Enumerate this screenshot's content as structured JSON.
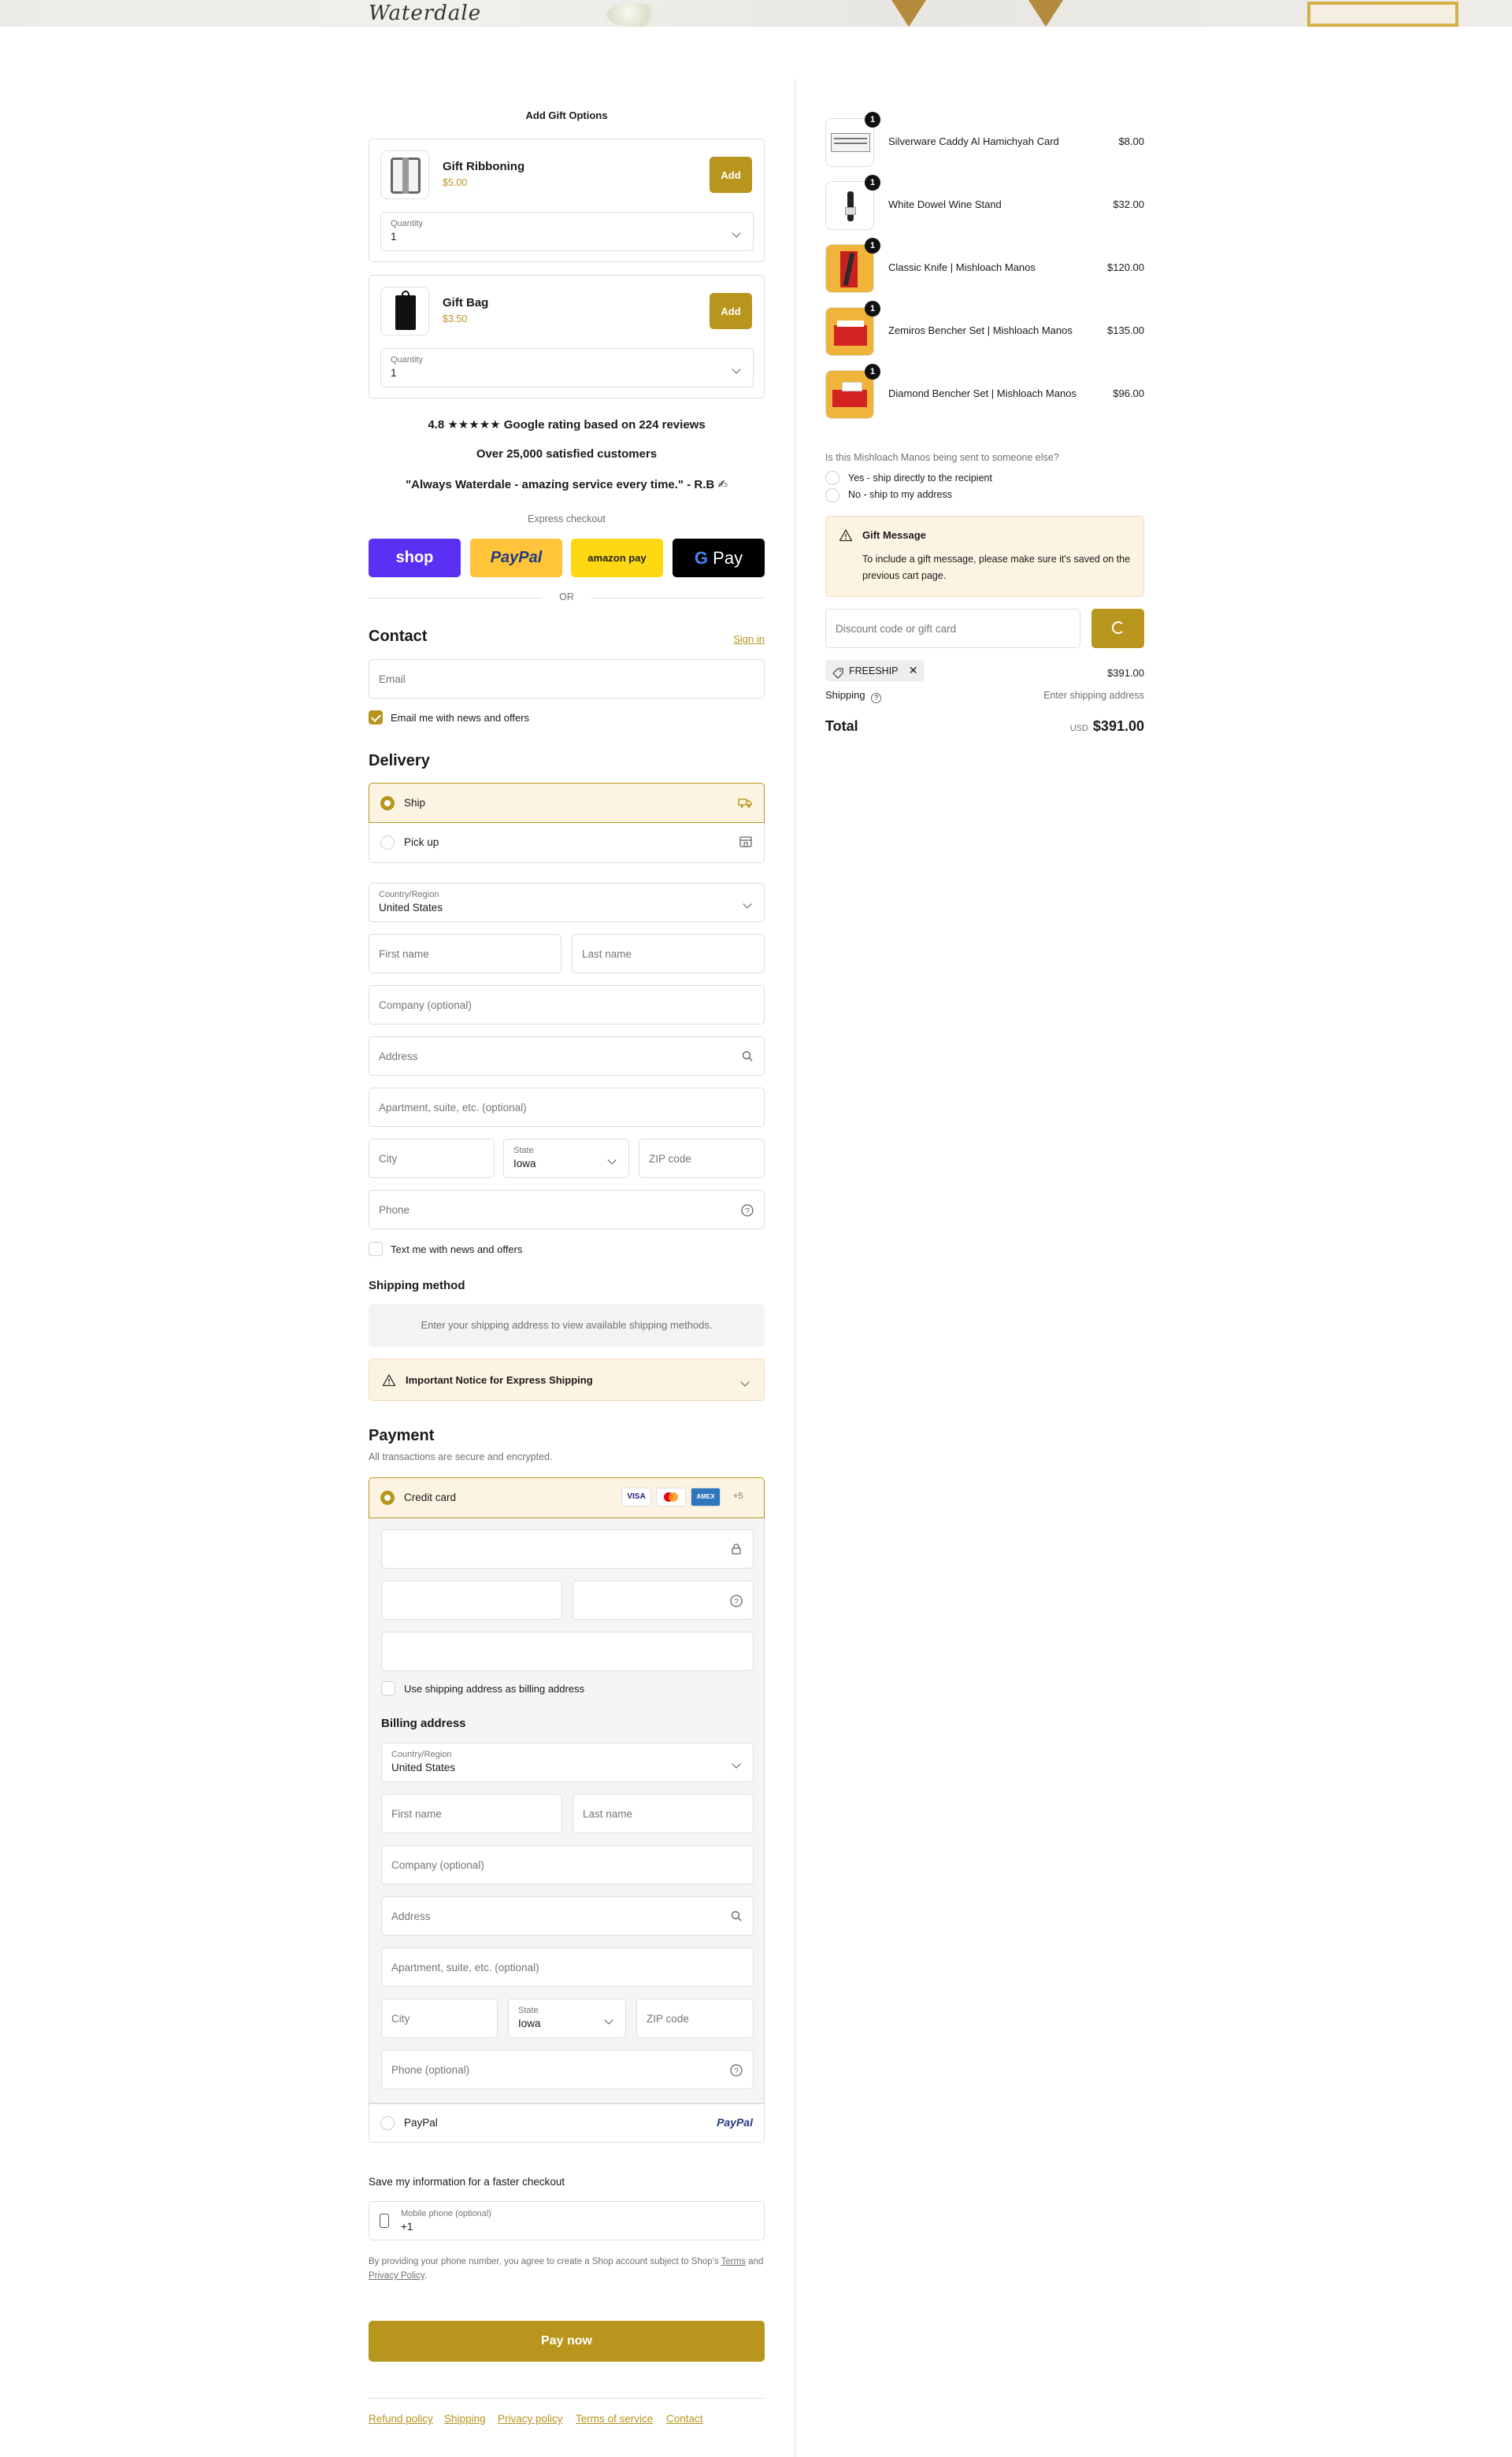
{
  "banner": {
    "logo_text": "Waterdale"
  },
  "gift_options": {
    "title": "Add Gift Options",
    "items": [
      {
        "name": "Gift Ribboning",
        "price": "$5.00",
        "button": "Add",
        "qty_label": "Quantity",
        "qty_value": "1"
      },
      {
        "name": "Gift Bag",
        "price": "$3.50",
        "button": "Add",
        "qty_label": "Quantity",
        "qty_value": "1"
      }
    ]
  },
  "trust": {
    "rating": "4.8 ★★★★★ Google rating based on 224 reviews",
    "customers": "Over 25,000 satisfied customers",
    "quote": "\"Always Waterdale - amazing service every time.\" - R.B ✍"
  },
  "express": {
    "label": "Express checkout",
    "buttons": {
      "shop": "shop",
      "paypal": "PayPal",
      "amazon": "amazon pay",
      "gpay": "Pay"
    },
    "or": "OR"
  },
  "contact": {
    "title": "Contact",
    "sign_in": "Sign in",
    "email_placeholder": "Email",
    "news_label": "Email me with news and offers"
  },
  "delivery": {
    "title": "Delivery",
    "options": [
      {
        "label": "Ship"
      },
      {
        "label": "Pick up"
      }
    ],
    "country_label": "Country/Region",
    "country_value": "United States",
    "first_name": "First name",
    "last_name": "Last name",
    "company": "Company (optional)",
    "address": "Address",
    "apartment": "Apartment, suite, etc. (optional)",
    "city": "City",
    "state_label": "State",
    "state_value": "Iowa",
    "zip": "ZIP code",
    "phone": "Phone",
    "text_news": "Text me with news and offers"
  },
  "shipping_method": {
    "title": "Shipping method",
    "notice": "Enter your shipping address to view available shipping methods.",
    "express_notice": "Important Notice for Express Shipping"
  },
  "payment": {
    "title": "Payment",
    "subtitle": "All transactions are secure and encrypted.",
    "credit_card": "Credit card",
    "card_logos": {
      "visa": "VISA",
      "amex": "AMEX",
      "more": "+5"
    },
    "use_shipping": "Use shipping address as billing address",
    "billing_title": "Billing address",
    "country_label": "Country/Region",
    "country_value": "United States",
    "first_name": "First name",
    "last_name": "Last name",
    "company": "Company (optional)",
    "address": "Address",
    "apartment": "Apartment, suite, etc. (optional)",
    "city": "City",
    "state_label": "State",
    "state_value": "Iowa",
    "zip": "ZIP code",
    "phone": "Phone (optional)",
    "paypal": "PayPal",
    "paypal_logo": "PayPal"
  },
  "save_info": {
    "title": "Save my information for a faster checkout",
    "mobile_label": "Mobile phone (optional)",
    "mobile_value": "+1",
    "terms_prefix": "By providing your phone number, you agree to create a Shop account subject to Shop's",
    "terms_link": "Terms",
    "and_text": "and",
    "privacy_link": "Privacy Policy",
    "period": "."
  },
  "pay_now": "Pay now",
  "footer_links": [
    "Refund policy",
    "Shipping",
    "Privacy policy",
    "Terms of service",
    "Contact"
  ],
  "cart": {
    "items": [
      {
        "qty": "1",
        "name": "Silverware Caddy Al Hamichyah Card",
        "price": "$8.00"
      },
      {
        "qty": "1",
        "name": "White Dowel Wine Stand",
        "price": "$32.00"
      },
      {
        "qty": "1",
        "name": "Classic Knife | Mishloach Manos",
        "price": "$120.00"
      },
      {
        "qty": "1",
        "name": "Zemiros Bencher Set | Mishloach Manos",
        "price": "$135.00"
      },
      {
        "qty": "1",
        "name": "Diamond Bencher Set | Mishloach Manos",
        "price": "$96.00"
      }
    ],
    "question": "Is this Mishloach Manos being sent to someone else?",
    "answers": [
      "Yes - ship directly to the recipient",
      "No - ship to my address"
    ],
    "gift_message_title": "Gift Message",
    "gift_message_text": "To include a gift message, please make sure it's saved on the previous cart page.",
    "discount_placeholder": "Discount code or gift card",
    "code_tag": "FREESHIP",
    "subtotal": "$391.00",
    "shipping_label": "Shipping",
    "shipping_value": "Enter shipping address",
    "total_label": "Total",
    "currency": "USD",
    "total_value": "$391.00"
  },
  "colors": {
    "accent": "#b8961d",
    "shop": "#5a31f4",
    "paypal_yellow": "#ffc439",
    "amazon_yellow": "#ffd814",
    "notice_bg": "#fdf3e2"
  }
}
